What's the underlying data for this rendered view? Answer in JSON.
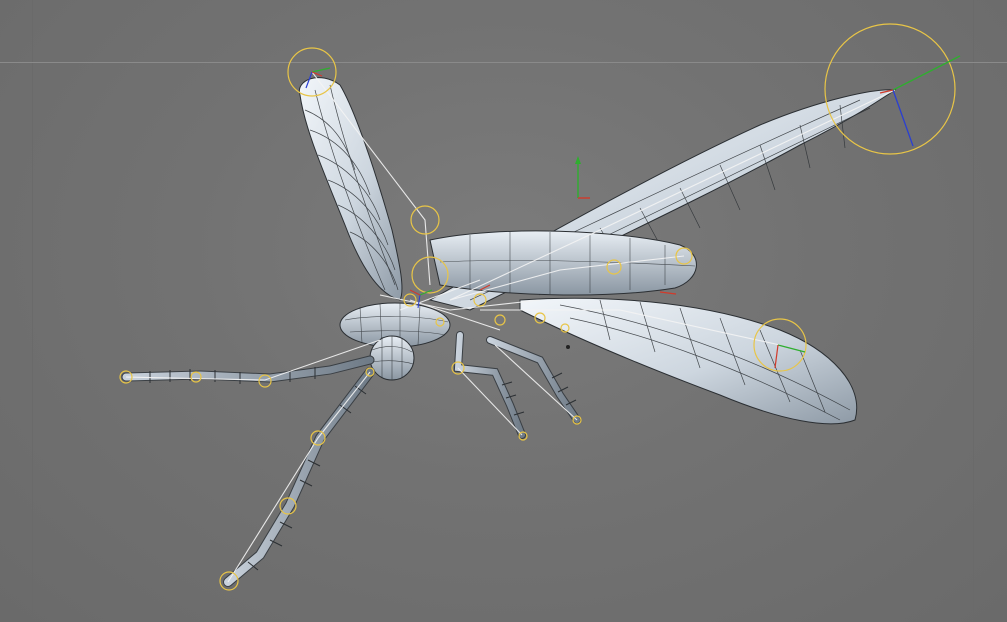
{
  "viewport": {
    "background": "#707070",
    "horizon_color": "#8a8a8a"
  },
  "model": {
    "subject": "mosquito rig",
    "mesh_fill": "#dfe6ee",
    "mesh_shade": "#9aa6b2",
    "wire_color": "#2b2f33",
    "joint_color": "#e8c547"
  },
  "axes": {
    "x_color": "#d23a2a",
    "y_color": "#2fae2f",
    "z_color": "#2a3fd2"
  },
  "icons": {
    "controller": "joint-circle-icon",
    "axis_gizmo": "axis-gizmo-icon"
  }
}
